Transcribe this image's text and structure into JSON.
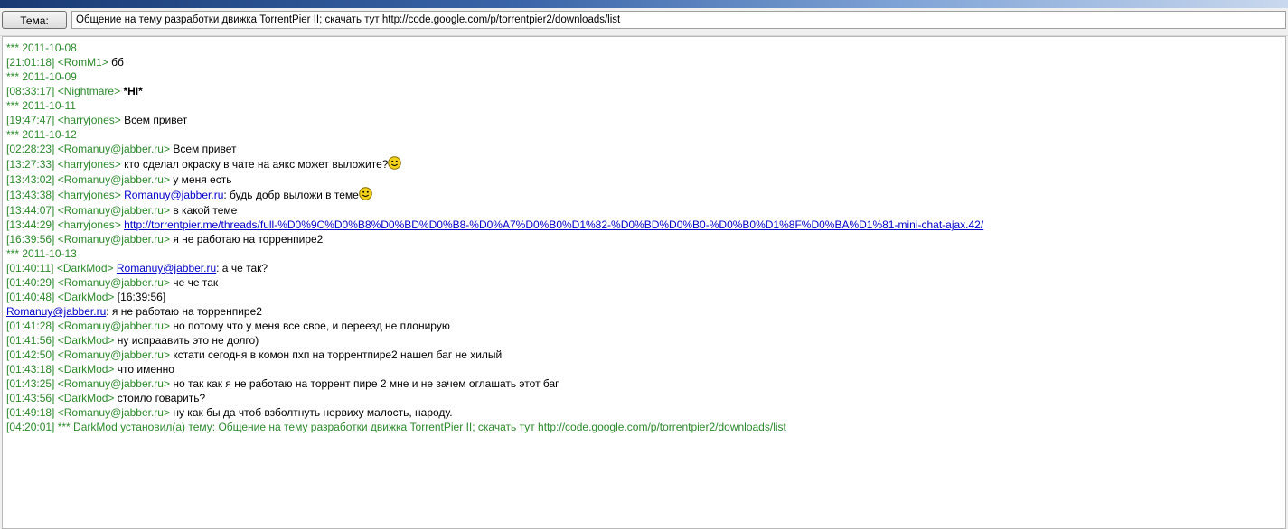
{
  "topic": {
    "button_label": "Тема:",
    "value": "Общение на тему разработки движка TorrentPier II; скачать тут http://code.google.com/p/torrentpier2/downloads/list"
  },
  "messages": [
    {
      "date": "*** 2011-10-08"
    },
    {
      "time": "[21:01:18]",
      "nick": "<RomM1>",
      "text": "бб"
    },
    {
      "date": "*** 2011-10-09"
    },
    {
      "time": "[08:33:17]",
      "nick": "<Nightmare>",
      "text": "*HI*"
    },
    {
      "date": "*** 2011-10-11"
    },
    {
      "time": "[19:47:47]",
      "nick": "<harryjones>",
      "text": "Всем привет"
    },
    {
      "date": "*** 2011-10-12"
    },
    {
      "time": "[02:28:23]",
      "nick": "<Romanuy@jabber.ru>",
      "text": "Всем привет"
    },
    {
      "time": "[13:27:33]",
      "nick": "<harryjones>",
      "text": "кто сделал окраску в чате на аякс может выложите?"
    },
    {
      "time": "[13:43:02]",
      "nick": "<Romanuy@jabber.ru>",
      "text": "у меня есть"
    },
    {
      "time": "[13:43:38]",
      "nick": "<harryjones>",
      "mention": "Romanuy@jabber.ru",
      "text": ": будь добр выложи в теме"
    },
    {
      "time": "[13:44:07]",
      "nick": "<Romanuy@jabber.ru>",
      "text": "в какой теме"
    },
    {
      "time": "[13:44:29]",
      "nick": "<harryjones>",
      "link": "http://torrentpier.me/threads/full-%D0%9C%D0%B8%D0%BD%D0%B8-%D0%A7%D0%B0%D1%82-%D0%BD%D0%B0-%D0%B0%D1%8F%D0%BA%D1%81-mini-chat-ajax.42/"
    },
    {
      "time": "[16:39:56]",
      "nick": "<Romanuy@jabber.ru>",
      "text": "я не работаю на торренпире2"
    },
    {
      "date": "*** 2011-10-13"
    },
    {
      "time": "[01:40:11]",
      "nick": "<DarkMod>",
      "mention": "Romanuy@jabber.ru",
      "text": ": а че так?"
    },
    {
      "time": "[01:40:29]",
      "nick": "<Romanuy@jabber.ru>",
      "text": "че че так"
    },
    {
      "time": "[01:40:48]",
      "nick": "<DarkMod>",
      "text": "[16:39:56]"
    },
    {
      "mention": "Romanuy@jabber.ru",
      "text": ": я не работаю на торренпире2"
    },
    {
      "time": "[01:41:28]",
      "nick": "<Romanuy@jabber.ru>",
      "text": "но потому что у меня все свое, и переезд не плонирую"
    },
    {
      "time": "[01:41:56]",
      "nick": "<DarkMod>",
      "text": "ну испраавить это не долго)"
    },
    {
      "time": "[01:42:50]",
      "nick": "<Romanuy@jabber.ru>",
      "text": "кстати сегодня в комон пхп на торрентпире2 нашел баг не хилый"
    },
    {
      "time": "[01:43:18]",
      "nick": "<DarkMod>",
      "text": "что именно"
    },
    {
      "time": "[01:43:25]",
      "nick": "<Romanuy@jabber.ru>",
      "text": "но так как я не работаю на торрент пире 2 мне и не зачем оглашать этот баг"
    },
    {
      "time": "[01:43:56]",
      "nick": "<DarkMod>",
      "text": "стоило говарить?"
    },
    {
      "time": "[01:49:18]",
      "nick": "<Romanuy@jabber.ru>",
      "text": "ну как бы да чтоб взболтнуть нервиху малость, народу."
    },
    {
      "system": "[04:20:01] *** DarkMod установил(а) тему: Общение на тему разработки движка TorrentPier II; скачать тут http://code.google.com/p/torrentpier2/downloads/list"
    }
  ],
  "colors": {
    "timestamp": "#2c8a2c",
    "link": "#0000cc"
  }
}
